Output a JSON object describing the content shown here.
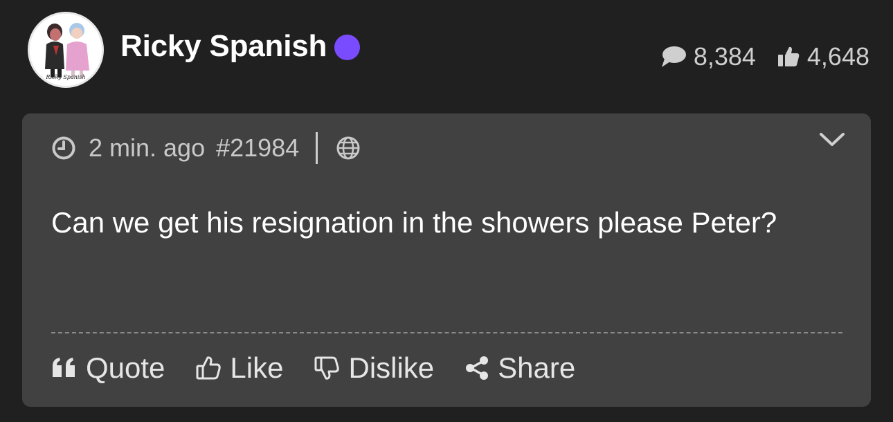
{
  "user": {
    "name": "Ricky Spanish",
    "avatar_caption": "Ricky Spanish",
    "online_color": "#7a4cff"
  },
  "stats": {
    "comments": "8,384",
    "likes": "4,648"
  },
  "post": {
    "time_ago": "2 min. ago",
    "post_id": "#21984",
    "text": "Can we get his resignation in the showers please Peter?",
    "visibility_icon": "globe-icon"
  },
  "actions": {
    "quote": "Quote",
    "like": "Like",
    "dislike": "Dislike",
    "share": "Share"
  }
}
